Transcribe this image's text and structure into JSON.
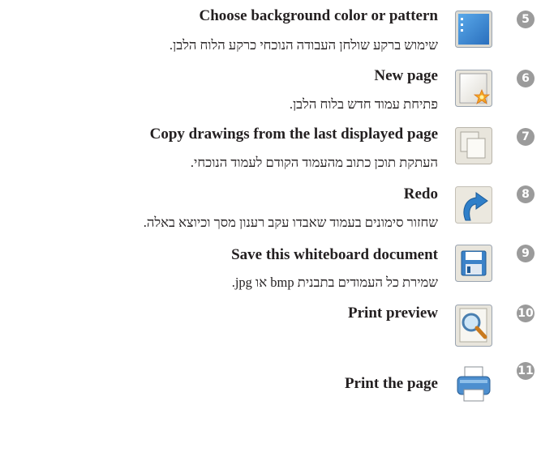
{
  "items": [
    {
      "badge": "5",
      "title": "Choose background color or pattern",
      "desc": "שימוש ברקע שולחן העבודה הנוכחי כרקע הלוח הלבן.",
      "icon": "background-icon"
    },
    {
      "badge": "6",
      "title": "New page",
      "desc": "פתיחת עמוד חדש בלוח הלבן.",
      "icon": "new-page-icon"
    },
    {
      "badge": "7",
      "title": "Copy drawings from the last displayed page",
      "desc": "העתקת תוכן כתוב מהעמוד הקודם לעמוד הנוכחי.",
      "icon": "copy-pages-icon"
    },
    {
      "badge": "8",
      "title": "Redo",
      "desc": "שחזור סימונים בעמוד שאבדו עקב רענון מסך וכיוצא באלה.",
      "icon": "redo-icon"
    },
    {
      "badge": "9",
      "title": "Save this whiteboard document",
      "desc": "שמירת כל העמודים בתבנית bmp או jpg.",
      "icon": "save-icon"
    },
    {
      "badge": "10",
      "title": "Print preview",
      "desc": "",
      "icon": "print-preview-icon"
    },
    {
      "badge": "11",
      "title": "Print the page",
      "desc": "",
      "icon": "printer-icon"
    }
  ]
}
